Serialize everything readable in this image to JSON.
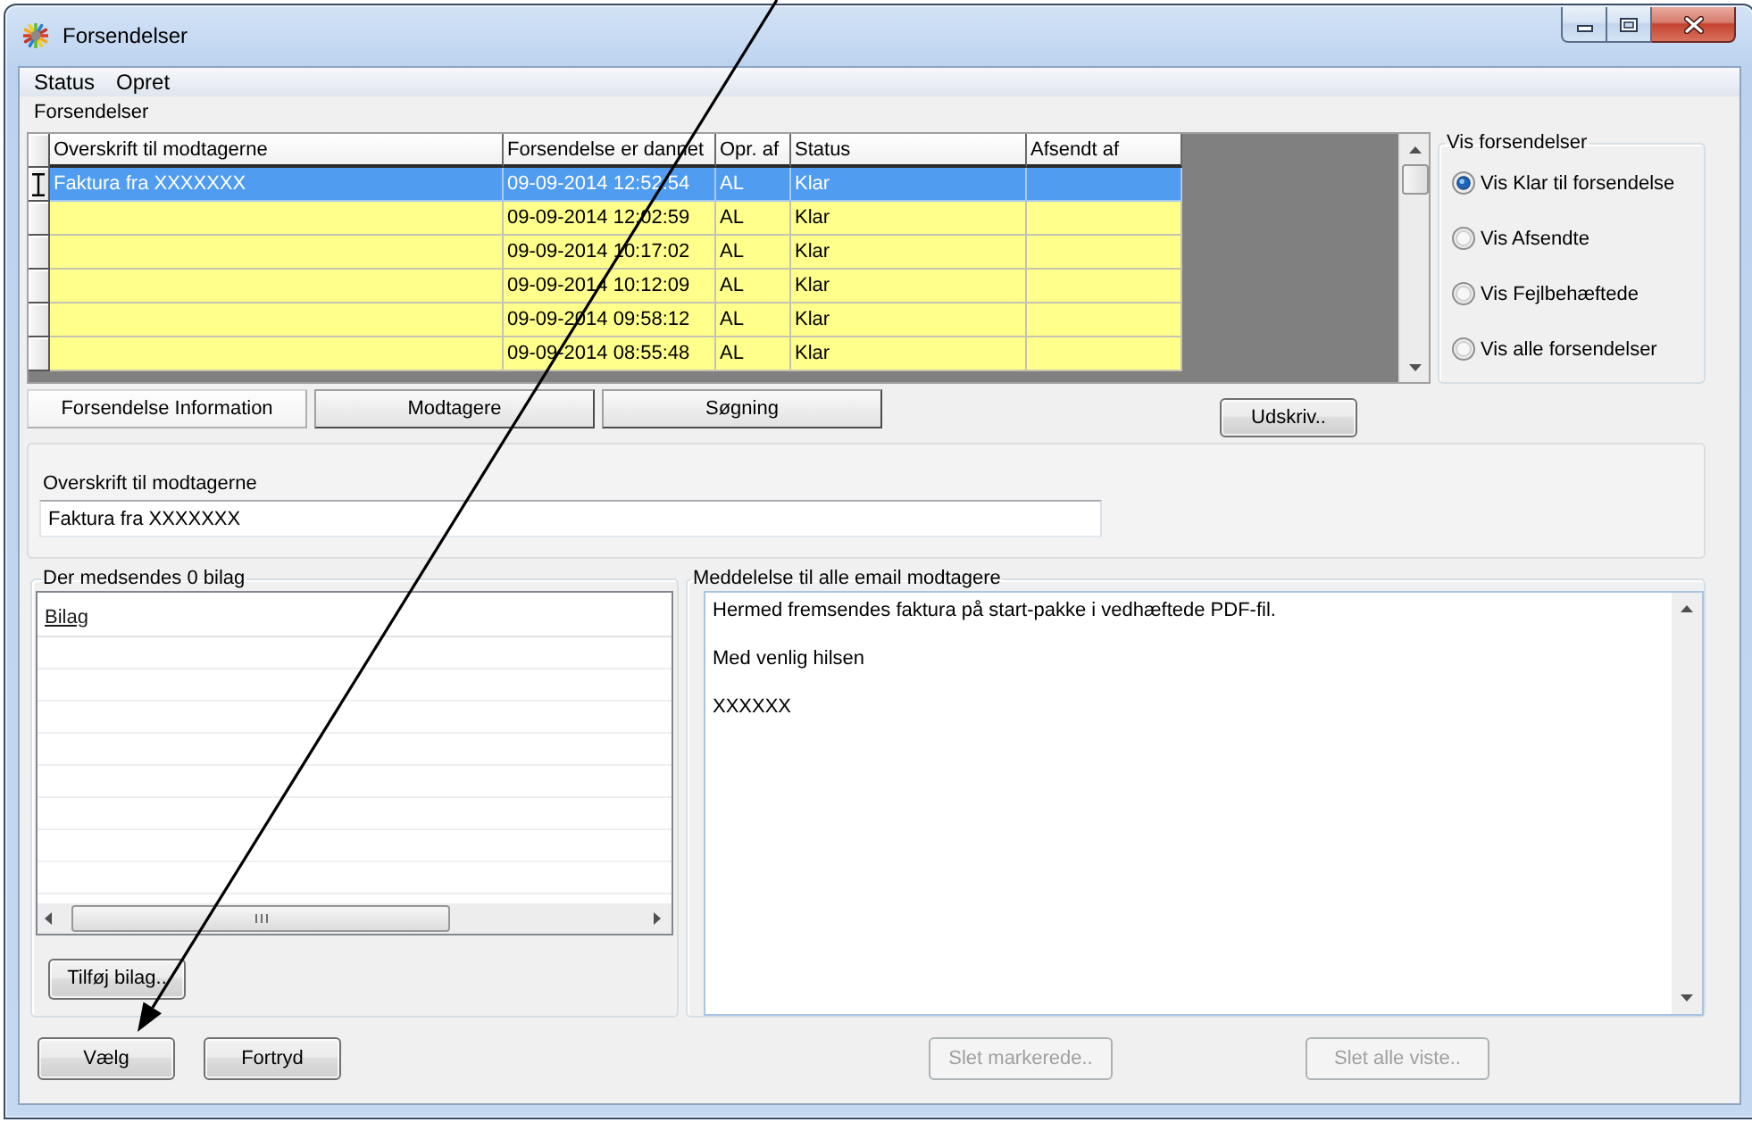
{
  "window": {
    "title": "Forsendelser"
  },
  "menu": [
    {
      "label": "Status"
    },
    {
      "label": "Opret"
    }
  ],
  "grid": {
    "caption": "Forsendelser",
    "columns": [
      "Overskrift til modtagerne",
      "Forsendelse er dannet",
      "Opr. af",
      "Status",
      "Afsendt af"
    ],
    "rows": [
      {
        "selected": true,
        "current": true,
        "subject": "Faktura fra XXXXXXX",
        "created": "09-09-2014 12:52:54",
        "created_by": "AL",
        "status": "Klar"
      },
      {
        "selected": false,
        "current": false,
        "created": "09-09-2014 12:02:59",
        "created_by": "AL",
        "status": "Klar"
      },
      {
        "selected": false,
        "current": false,
        "created": "09-09-2014 10:17:02",
        "created_by": "AL",
        "status": "Klar"
      },
      {
        "selected": false,
        "current": false,
        "created": "09-09-2014 10:12:09",
        "created_by": "AL",
        "status": "Klar"
      },
      {
        "selected": false,
        "current": false,
        "created": "09-09-2014 09:58:12",
        "created_by": "AL",
        "status": "Klar"
      },
      {
        "selected": false,
        "current": false,
        "created": "09-09-2014 08:55:48",
        "created_by": "AL",
        "status": "Klar"
      }
    ]
  },
  "filter": {
    "title": "Vis forsendelser",
    "options": [
      {
        "label": "Vis Klar til forsendelse",
        "selected": true
      },
      {
        "label": "Vis Afsendte",
        "selected": false
      },
      {
        "label": "Vis Fejlbehæftede",
        "selected": false
      },
      {
        "label": "Vis alle forsendelser",
        "selected": false
      }
    ]
  },
  "tabs": [
    {
      "label": "Forsendelse Information",
      "selected": true
    },
    {
      "label": "Modtagere",
      "selected": false
    },
    {
      "label": "Søgning",
      "selected": false
    }
  ],
  "print_button": {
    "label": "Udskriv.."
  },
  "subject": {
    "label": "Overskrift til modtagerne",
    "value": "Faktura fra XXXXXXX"
  },
  "attachments": {
    "title": "Der medsendes 0 bilag",
    "columns": [
      "Bilag"
    ],
    "add_button": {
      "label": "Tilføj bilag.."
    }
  },
  "message": {
    "title": "Meddelelse til alle email modtagere",
    "paragraphs": [
      "Hermed fremsendes faktura på start-pakke i vedhæftede PDF-fil.",
      "Med venlig hilsen",
      "XXXXXX"
    ]
  },
  "buttons": [
    {
      "label": "Vælg",
      "disabled": false
    },
    {
      "label": "Fortryd",
      "disabled": false
    },
    {
      "label": "Slet markerede..",
      "disabled": true
    },
    {
      "label": "Slet alle viste..",
      "disabled": true
    }
  ]
}
